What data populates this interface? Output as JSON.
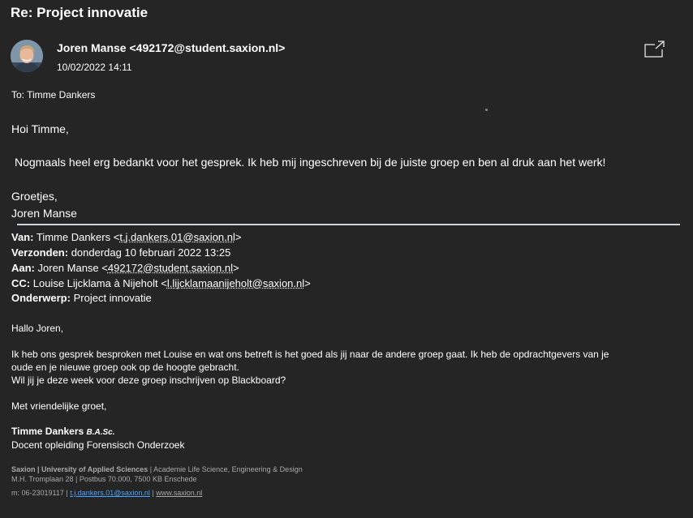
{
  "subject": "Re: Project innovatie",
  "sender": {
    "name": "Joren Manse",
    "email": "<492172@student.saxion.nl>",
    "datetime": "10/02/2022 14:11",
    "avatar": "avatar-photo"
  },
  "popout_icon": "popout-window-icon",
  "to_line": "To: Timme Dankers",
  "reply": {
    "greeting": "Hoi Timme,",
    "text": "Nogmaals heel erg bedankt voor het gesprek. Ik heb mij ingeschreven bij de juiste groep en ben al druk aan het werk!",
    "closing": "Groetjes,",
    "name": "Joren Manse"
  },
  "quoted_header": {
    "van_label": "Van:",
    "van_name": "Timme Dankers <",
    "van_email": "t.j.dankers.01@saxion.nl",
    "van_end": ">",
    "verzonden_label": "Verzonden:",
    "verzonden_value": "donderdag 10 februari 2022 13:25",
    "aan_label": "Aan:",
    "aan_name": "Joren Manse <",
    "aan_email": "492172@student.saxion.nl",
    "aan_end": ">",
    "cc_label": "CC:",
    "cc_name": "Louise Lijcklama à Nijeholt <",
    "cc_email": "l.lijcklamaanijeholt@saxion.nl",
    "cc_end": ">",
    "onderwerp_label": "Onderwerp:",
    "onderwerp_value": "Project innovatie"
  },
  "quoted_body": {
    "greeting": "Hallo Joren,",
    "paragraph_line1": "Ik heb ons gesprek besproken met Louise en wat ons betreft is het goed als jij naar de andere groep gaat. Ik heb de opdrachtgevers van je",
    "paragraph_line2": "oude en je nieuwe groep ook op de hoogte gebracht.",
    "paragraph_line3": "Wil jij je deze week voor deze groep inschrijven op Blackboard?",
    "closing": "Met vriendelijke groet,"
  },
  "signature": {
    "name": "Timme Dankers",
    "title": "B.A.Sc.",
    "role": "Docent opleiding Forensisch Onderzoek"
  },
  "footer": {
    "org": "Saxion | University of Applied Sciences",
    "org_rest": " | Academie Life Science, Engineering & Design",
    "address": "M.H. Tromplaan 28 | Postbus 70.000, 7500 KB Enschede",
    "phone": "m: 06-23019117 | ",
    "email": "t.j.dankers.01@saxion.nl",
    "sep": " | ",
    "website": "www.saxion.nl"
  }
}
